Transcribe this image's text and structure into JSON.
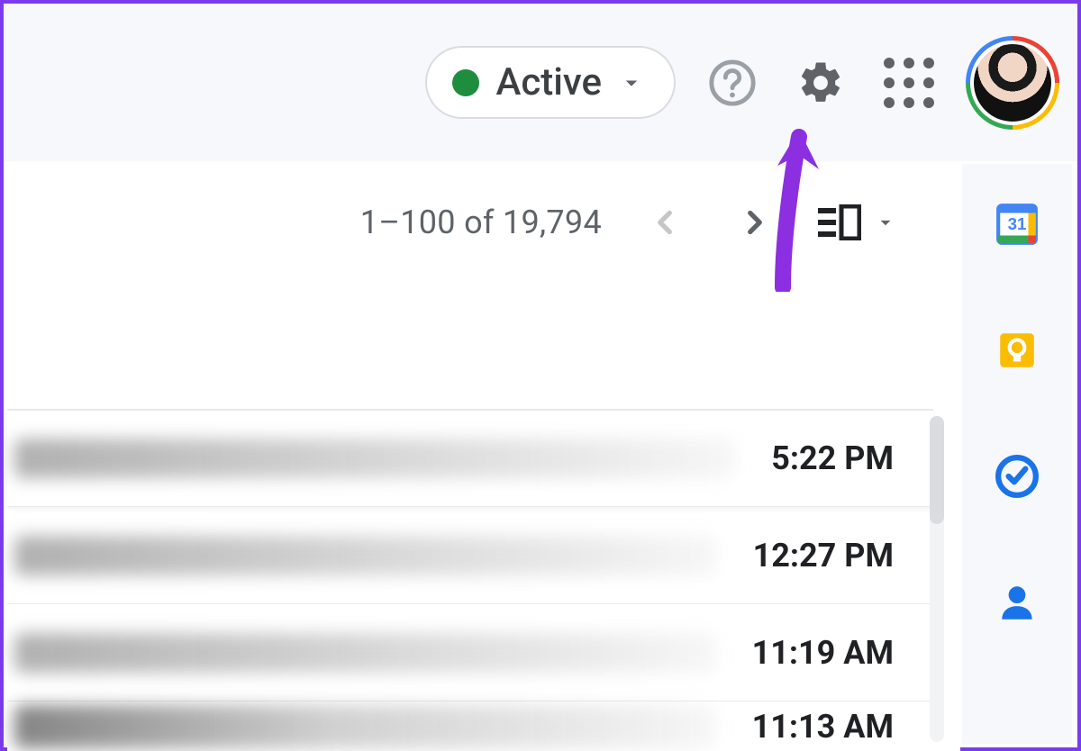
{
  "header": {
    "status_label": "Active",
    "status_color": "#1e8e3e"
  },
  "toolbar": {
    "page_count": "1–100 of 19,794"
  },
  "emails": [
    {
      "time": "5:22 PM"
    },
    {
      "time": "12:27 PM"
    },
    {
      "time": "11:19 AM"
    },
    {
      "time": "11:13 AM"
    }
  ],
  "side_apps": {
    "calendar_day": "31"
  }
}
